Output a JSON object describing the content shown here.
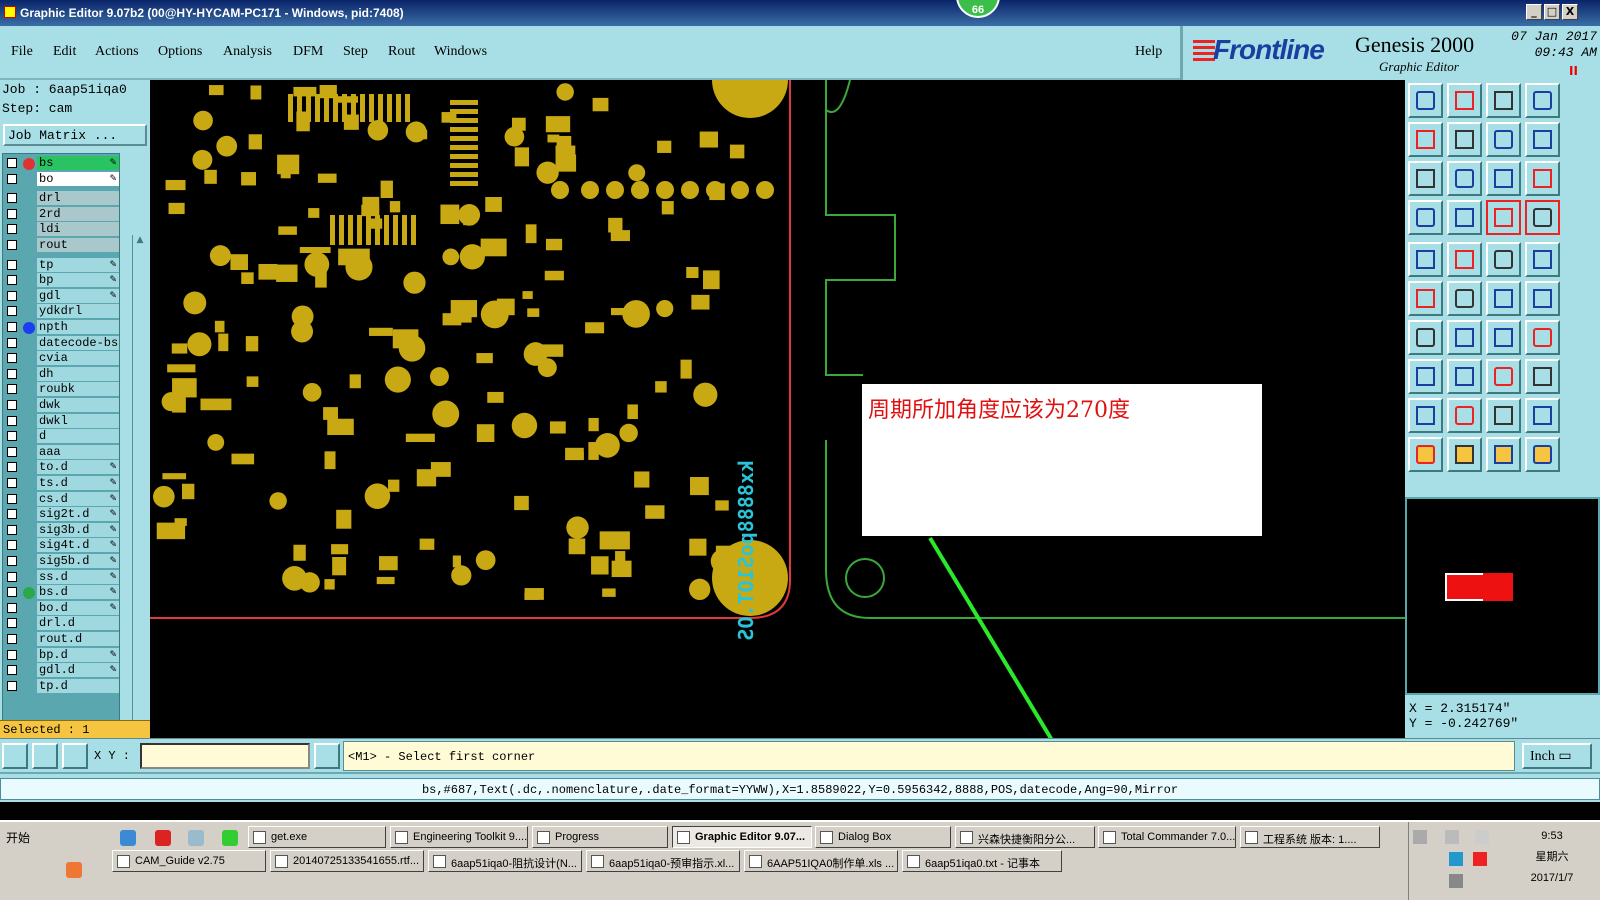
{
  "window": {
    "title": "Graphic Editor 9.07b2 (00@HY-HYCAM-PC171 - Windows, pid:7408)",
    "badge": "66",
    "controls": [
      "_",
      "□",
      "X"
    ]
  },
  "menu": {
    "items": [
      "File",
      "Edit",
      "Actions",
      "Options",
      "Analysis",
      "DFM",
      "Step",
      "Rout",
      "Windows"
    ],
    "help": "Help"
  },
  "brand": {
    "logo": "Frontline",
    "product": "Genesis 2000",
    "subtitle": "Graphic Editor",
    "date": "07 Jan 2017",
    "time": "09:43 AM",
    "record_indicator": "II"
  },
  "left": {
    "job": "Job : 6aap51iqa0",
    "step": "Step: cam",
    "job_matrix": "Job Matrix ...",
    "selected": "Selected : 1",
    "layers": [
      {
        "name": "bs",
        "style": "green",
        "dot": "#d33",
        "pen": "✎"
      },
      {
        "name": "bo",
        "style": "white",
        "dot": "",
        "pen": "✎"
      },
      {
        "name": "drl",
        "style": "gray",
        "dot": "",
        "pen": ""
      },
      {
        "name": "2rd",
        "style": "gray",
        "dot": "",
        "pen": ""
      },
      {
        "name": "ldi",
        "style": "gray",
        "dot": "",
        "pen": ""
      },
      {
        "name": "rout",
        "style": "gray",
        "dot": "",
        "pen": ""
      },
      {
        "name": "tp",
        "style": "",
        "dot": "",
        "pen": "✎"
      },
      {
        "name": "bp",
        "style": "",
        "dot": "",
        "pen": "✎"
      },
      {
        "name": "gdl",
        "style": "",
        "dot": "",
        "pen": "✎"
      },
      {
        "name": "ydkdrl",
        "style": "",
        "dot": "",
        "pen": ""
      },
      {
        "name": "npth",
        "style": "",
        "dot": "#1b3ff0",
        "pen": ""
      },
      {
        "name": "datecode-bs",
        "style": "",
        "dot": "",
        "pen": ""
      },
      {
        "name": "cvia",
        "style": "",
        "dot": "",
        "pen": ""
      },
      {
        "name": "dh",
        "style": "",
        "dot": "",
        "pen": ""
      },
      {
        "name": "roubk",
        "style": "",
        "dot": "",
        "pen": ""
      },
      {
        "name": "dwk",
        "style": "",
        "dot": "",
        "pen": ""
      },
      {
        "name": "dwkl",
        "style": "",
        "dot": "",
        "pen": ""
      },
      {
        "name": "d",
        "style": "",
        "dot": "",
        "pen": ""
      },
      {
        "name": "aaa",
        "style": "",
        "dot": "",
        "pen": ""
      },
      {
        "name": "to.d",
        "style": "",
        "dot": "",
        "pen": "✎"
      },
      {
        "name": "ts.d",
        "style": "",
        "dot": "",
        "pen": "✎"
      },
      {
        "name": "cs.d",
        "style": "",
        "dot": "",
        "pen": "✎"
      },
      {
        "name": "sig2t.d",
        "style": "",
        "dot": "",
        "pen": "✎"
      },
      {
        "name": "sig3b.d",
        "style": "",
        "dot": "",
        "pen": "✎"
      },
      {
        "name": "sig4t.d",
        "style": "",
        "dot": "",
        "pen": "✎"
      },
      {
        "name": "sig5b.d",
        "style": "",
        "dot": "",
        "pen": "✎"
      },
      {
        "name": "ss.d",
        "style": "",
        "dot": "",
        "pen": "✎"
      },
      {
        "name": "bs.d",
        "style": "",
        "dot": "#2aa84a",
        "pen": "✎"
      },
      {
        "name": "bo.d",
        "style": "",
        "dot": "",
        "pen": "✎"
      },
      {
        "name": "drl.d",
        "style": "",
        "dot": "",
        "pen": ""
      },
      {
        "name": "rout.d",
        "style": "",
        "dot": "",
        "pen": ""
      },
      {
        "name": "bp.d",
        "style": "",
        "dot": "",
        "pen": "✎"
      },
      {
        "name": "gdl.d",
        "style": "",
        "dot": "",
        "pen": "✎"
      },
      {
        "name": "tp.d",
        "style": "",
        "dot": "",
        "pen": ""
      }
    ]
  },
  "canvas": {
    "annotation": "周期所加角度应该为270度",
    "vertical_text": "kx8888poS1OT.OS",
    "colors": {
      "pad": "#c8a813",
      "outline": "#e23a3a",
      "profile": "#3aa83a",
      "arrow": "#2ae82a"
    }
  },
  "coords": {
    "x": "X  =  2.315174\"",
    "y": "Y  = -0.242769\""
  },
  "command": {
    "xy_label": "X Y :",
    "xy_value": "",
    "prompt": "<M1> - Select first corner",
    "units": "Inch ▭"
  },
  "info": "bs,#687,Text(.dc,.nomenclature,.date_format=YYWW),X=1.8589022,Y=0.5956342,8888,POS,datecode,Ang=90,Mirror",
  "taskbar": {
    "start": "开始",
    "row1": [
      "get.exe",
      "Engineering Toolkit 9....",
      "Progress",
      "Graphic Editor 9.07...",
      "Dialog Box",
      "兴森快捷衡阳分公...",
      "Total Commander 7.0...",
      "工程系统  版本: 1...."
    ],
    "row2": [
      "CAM_Guide v2.75",
      "20140725133541655.rtf...",
      "6aap51iqa0-阻抗设计(N...",
      "6aap51iqa0-预审指示.xl...",
      "6AAP51IQA0制作单.xls ...",
      "6aap51iqa0.txt - 记事本"
    ],
    "clock_time": "9:53",
    "clock_day": "星期六",
    "clock_date": "2017/1/7"
  }
}
